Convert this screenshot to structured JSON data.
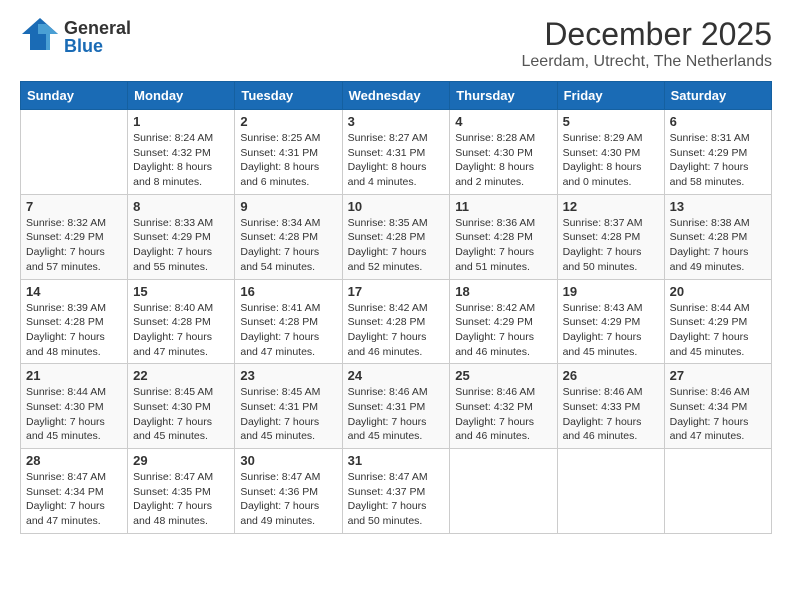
{
  "logo": {
    "general": "General",
    "blue": "Blue"
  },
  "title": {
    "month": "December 2025",
    "location": "Leerdam, Utrecht, The Netherlands"
  },
  "weekdays": [
    "Sunday",
    "Monday",
    "Tuesday",
    "Wednesday",
    "Thursday",
    "Friday",
    "Saturday"
  ],
  "weeks": [
    [
      {
        "day": "",
        "info": ""
      },
      {
        "day": "1",
        "info": "Sunrise: 8:24 AM\nSunset: 4:32 PM\nDaylight: 8 hours\nand 8 minutes."
      },
      {
        "day": "2",
        "info": "Sunrise: 8:25 AM\nSunset: 4:31 PM\nDaylight: 8 hours\nand 6 minutes."
      },
      {
        "day": "3",
        "info": "Sunrise: 8:27 AM\nSunset: 4:31 PM\nDaylight: 8 hours\nand 4 minutes."
      },
      {
        "day": "4",
        "info": "Sunrise: 8:28 AM\nSunset: 4:30 PM\nDaylight: 8 hours\nand 2 minutes."
      },
      {
        "day": "5",
        "info": "Sunrise: 8:29 AM\nSunset: 4:30 PM\nDaylight: 8 hours\nand 0 minutes."
      },
      {
        "day": "6",
        "info": "Sunrise: 8:31 AM\nSunset: 4:29 PM\nDaylight: 7 hours\nand 58 minutes."
      }
    ],
    [
      {
        "day": "7",
        "info": "Sunrise: 8:32 AM\nSunset: 4:29 PM\nDaylight: 7 hours\nand 57 minutes."
      },
      {
        "day": "8",
        "info": "Sunrise: 8:33 AM\nSunset: 4:29 PM\nDaylight: 7 hours\nand 55 minutes."
      },
      {
        "day": "9",
        "info": "Sunrise: 8:34 AM\nSunset: 4:28 PM\nDaylight: 7 hours\nand 54 minutes."
      },
      {
        "day": "10",
        "info": "Sunrise: 8:35 AM\nSunset: 4:28 PM\nDaylight: 7 hours\nand 52 minutes."
      },
      {
        "day": "11",
        "info": "Sunrise: 8:36 AM\nSunset: 4:28 PM\nDaylight: 7 hours\nand 51 minutes."
      },
      {
        "day": "12",
        "info": "Sunrise: 8:37 AM\nSunset: 4:28 PM\nDaylight: 7 hours\nand 50 minutes."
      },
      {
        "day": "13",
        "info": "Sunrise: 8:38 AM\nSunset: 4:28 PM\nDaylight: 7 hours\nand 49 minutes."
      }
    ],
    [
      {
        "day": "14",
        "info": "Sunrise: 8:39 AM\nSunset: 4:28 PM\nDaylight: 7 hours\nand 48 minutes."
      },
      {
        "day": "15",
        "info": "Sunrise: 8:40 AM\nSunset: 4:28 PM\nDaylight: 7 hours\nand 47 minutes."
      },
      {
        "day": "16",
        "info": "Sunrise: 8:41 AM\nSunset: 4:28 PM\nDaylight: 7 hours\nand 47 minutes."
      },
      {
        "day": "17",
        "info": "Sunrise: 8:42 AM\nSunset: 4:28 PM\nDaylight: 7 hours\nand 46 minutes."
      },
      {
        "day": "18",
        "info": "Sunrise: 8:42 AM\nSunset: 4:29 PM\nDaylight: 7 hours\nand 46 minutes."
      },
      {
        "day": "19",
        "info": "Sunrise: 8:43 AM\nSunset: 4:29 PM\nDaylight: 7 hours\nand 45 minutes."
      },
      {
        "day": "20",
        "info": "Sunrise: 8:44 AM\nSunset: 4:29 PM\nDaylight: 7 hours\nand 45 minutes."
      }
    ],
    [
      {
        "day": "21",
        "info": "Sunrise: 8:44 AM\nSunset: 4:30 PM\nDaylight: 7 hours\nand 45 minutes."
      },
      {
        "day": "22",
        "info": "Sunrise: 8:45 AM\nSunset: 4:30 PM\nDaylight: 7 hours\nand 45 minutes."
      },
      {
        "day": "23",
        "info": "Sunrise: 8:45 AM\nSunset: 4:31 PM\nDaylight: 7 hours\nand 45 minutes."
      },
      {
        "day": "24",
        "info": "Sunrise: 8:46 AM\nSunset: 4:31 PM\nDaylight: 7 hours\nand 45 minutes."
      },
      {
        "day": "25",
        "info": "Sunrise: 8:46 AM\nSunset: 4:32 PM\nDaylight: 7 hours\nand 46 minutes."
      },
      {
        "day": "26",
        "info": "Sunrise: 8:46 AM\nSunset: 4:33 PM\nDaylight: 7 hours\nand 46 minutes."
      },
      {
        "day": "27",
        "info": "Sunrise: 8:46 AM\nSunset: 4:34 PM\nDaylight: 7 hours\nand 47 minutes."
      }
    ],
    [
      {
        "day": "28",
        "info": "Sunrise: 8:47 AM\nSunset: 4:34 PM\nDaylight: 7 hours\nand 47 minutes."
      },
      {
        "day": "29",
        "info": "Sunrise: 8:47 AM\nSunset: 4:35 PM\nDaylight: 7 hours\nand 48 minutes."
      },
      {
        "day": "30",
        "info": "Sunrise: 8:47 AM\nSunset: 4:36 PM\nDaylight: 7 hours\nand 49 minutes."
      },
      {
        "day": "31",
        "info": "Sunrise: 8:47 AM\nSunset: 4:37 PM\nDaylight: 7 hours\nand 50 minutes."
      },
      {
        "day": "",
        "info": ""
      },
      {
        "day": "",
        "info": ""
      },
      {
        "day": "",
        "info": ""
      }
    ]
  ]
}
